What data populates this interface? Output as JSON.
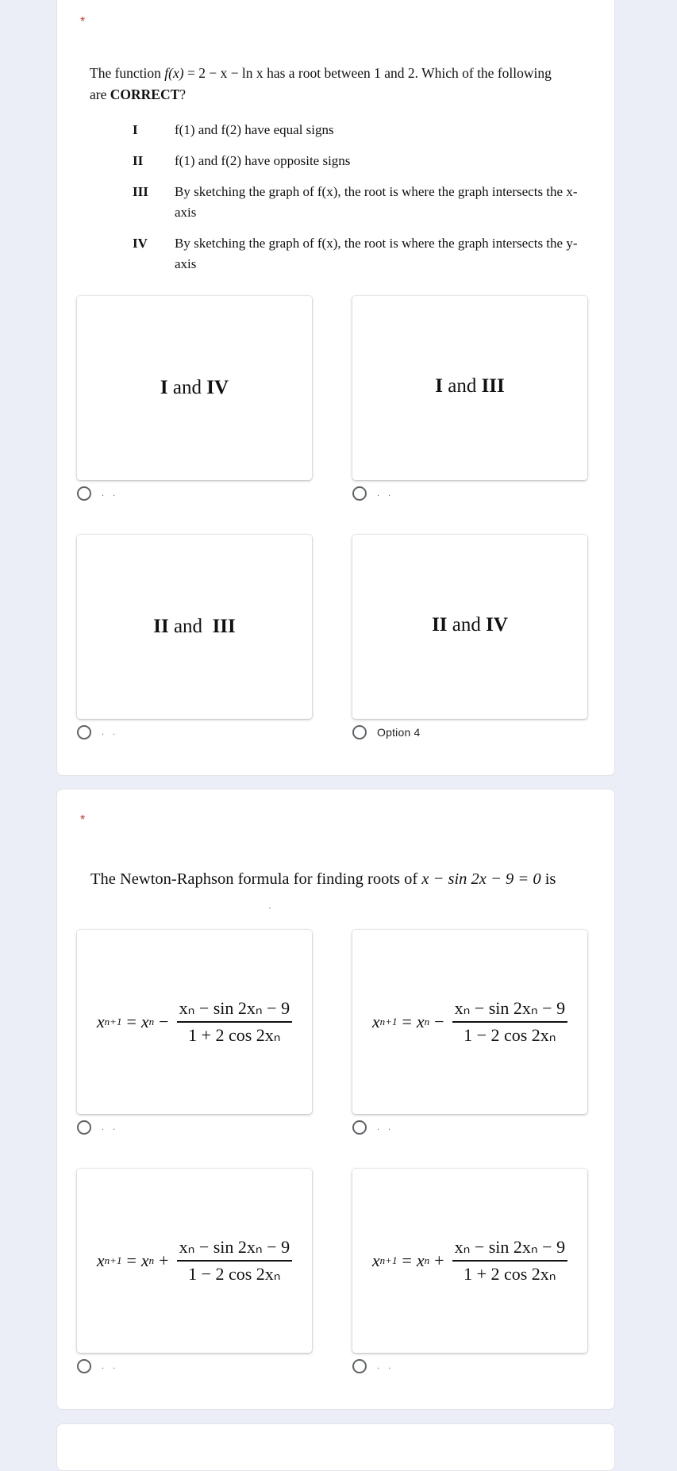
{
  "colors": {
    "page_background": "#ebeef6",
    "card_background": "#ffffff",
    "required_asterisk": "#d93025",
    "radio_border": "#5f6368"
  },
  "questions": [
    {
      "required_marker": "*",
      "prompt": {
        "before_fx": "The function ",
        "fx": "f(x)",
        "equation": "= 2 − x − ln x",
        "after": " has a root between 1 and 2. Which of the following",
        "line2_prefix": "are ",
        "line2_bold": "CORRECT",
        "line2_suffix": "?"
      },
      "statements": [
        {
          "numeral": "I",
          "text": "f(1) and f(2) have equal signs"
        },
        {
          "numeral": "II",
          "text": "f(1) and f(2) have opposite signs"
        },
        {
          "numeral": "III",
          "text": "By sketching the graph of f(x), the root is where the graph intersects the x-axis"
        },
        {
          "numeral": "IV",
          "text": "By sketching the graph of f(x), the root is where the graph intersects the y-axis"
        }
      ],
      "options": [
        {
          "image_text": {
            "a": "I",
            "mid": " and ",
            "b": "IV"
          },
          "label": ". .",
          "selected": false
        },
        {
          "image_text": {
            "a": "I",
            "mid": " and ",
            "b": "III"
          },
          "label": ". .",
          "selected": false
        },
        {
          "image_text": {
            "a": "II",
            "mid": " and  ",
            "b": "III"
          },
          "label": ". .",
          "selected": false
        },
        {
          "image_text": {
            "a": "II",
            "mid": " and ",
            "b": "IV"
          },
          "label": "Option 4",
          "selected": false
        }
      ]
    },
    {
      "required_marker": "*",
      "prompt": {
        "text": "The Newton-Raphson formula for finding roots of ",
        "equation": "x − sin 2x − 9 = 0",
        "suffix": " is"
      },
      "options": [
        {
          "formula": {
            "lhs": "x",
            "lhs_sub": "n+1",
            "eq": "=",
            "x": "x",
            "x_sub": "n",
            "sign": "−",
            "numerator": "xₙ − sin 2xₙ − 9",
            "denominator": "1 + 2 cos 2xₙ"
          },
          "label": ". .",
          "selected": false
        },
        {
          "formula": {
            "lhs": "x",
            "lhs_sub": "n+1",
            "eq": "=",
            "x": "x",
            "x_sub": "n",
            "sign": "−",
            "numerator": "xₙ − sin 2xₙ − 9",
            "denominator": "1 − 2 cos 2xₙ"
          },
          "label": ". .",
          "selected": false
        },
        {
          "formula": {
            "lhs": "x",
            "lhs_sub": "n+1",
            "eq": "=",
            "x": "x",
            "x_sub": "n",
            "sign": "+",
            "numerator": "xₙ − sin 2xₙ − 9",
            "denominator": "1 − 2 cos 2xₙ"
          },
          "label": ". .",
          "selected": false
        },
        {
          "formula": {
            "lhs": "x",
            "lhs_sub": "n+1",
            "eq": "=",
            "x": "x",
            "x_sub": "n",
            "sign": "+",
            "numerator": "xₙ − sin 2xₙ − 9",
            "denominator": "1 + 2 cos 2xₙ"
          },
          "label": ". .",
          "selected": false
        }
      ]
    }
  ]
}
